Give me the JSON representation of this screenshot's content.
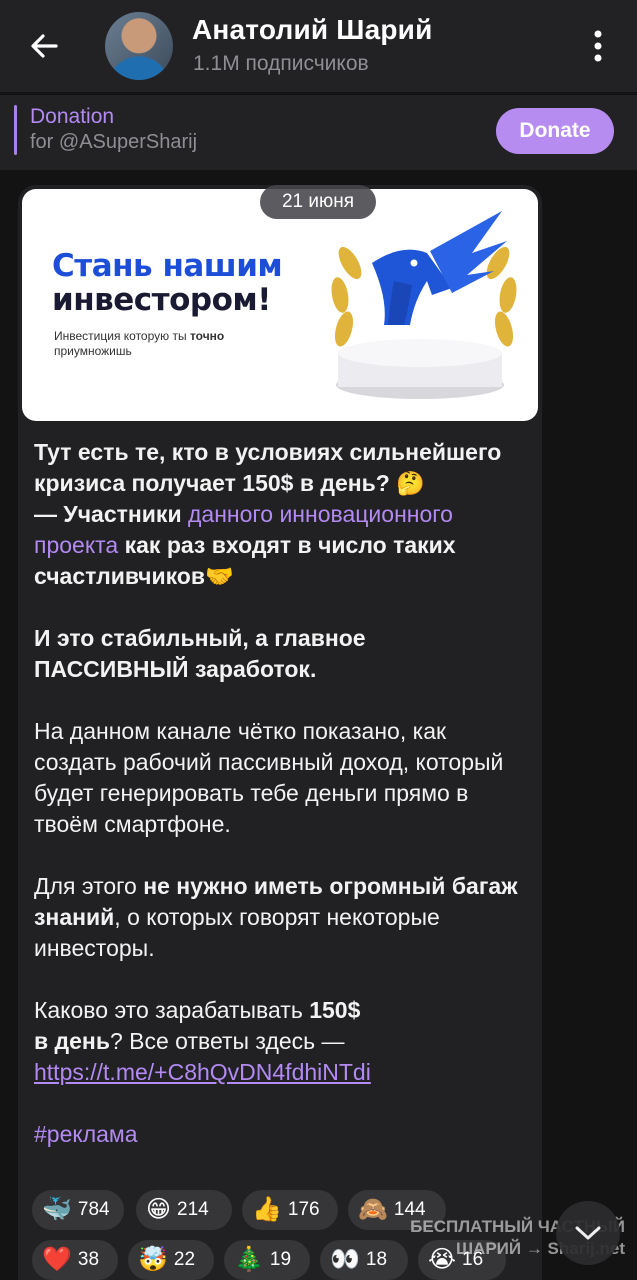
{
  "header": {
    "title": "Анатолий Шарий",
    "subtitle": "1.1M подписчиков"
  },
  "pinned": {
    "title": "Donation",
    "subtitle": "for @ASuperSharij",
    "button_label": "Donate"
  },
  "post": {
    "date": "21 июня",
    "ad_image": {
      "headline_line1": "Стань нашим",
      "headline_line2": "инвестором!",
      "subtext_part1": "Инвестиция которую ты ",
      "subtext_bold": "точно",
      "subtext_part2": " приумножишь"
    },
    "p1_bold_a": "Тут есть те, кто в условиях сильнейшего кризиса получает 150$ в день?",
    "p1_emoji": "🤔",
    "p1_bold_b": "— Участники ",
    "p1_link": "данного инновационного проекта",
    "p1_bold_c": " как раз входят в число таких счастливчиков",
    "p1_emoji2": "🤝",
    "p2": "И это стабильный, а главное ПАССИВНЫЙ заработок.",
    "p3": "На данном канале чётко показано, как создать рабочий пассивный доход, который будет генерировать тебе деньги прямо в твоём смартфоне.",
    "p4_a": "Для этого ",
    "p4_bold": "не нужно иметь огромный багаж знаний",
    "p4_b": ", о которых говорят некоторые инвесторы.",
    "p5_a": "Каково это зарабатывать ",
    "p5_bold1": "150$",
    "p5_bold2": "в день",
    "p5_b": "? Все ответы здесь —",
    "url": "https://t.me/+C8hQvDN4fdhiNTdi",
    "hashtag": "#реклама"
  },
  "reactions": [
    {
      "emoji": "🐳",
      "count": "784"
    },
    {
      "emoji": "😁",
      "count": "214"
    },
    {
      "emoji": "👍",
      "count": "176"
    },
    {
      "emoji": "🙈",
      "count": "144"
    },
    {
      "emoji": "❤️",
      "count": "38"
    },
    {
      "emoji": "🤯",
      "count": "22"
    },
    {
      "emoji": "🎄",
      "count": "19"
    },
    {
      "emoji": "👀",
      "count": "18"
    },
    {
      "emoji": "😭",
      "count": "16"
    }
  ],
  "watermark": {
    "line1": "БЕСПЛАТНЫЙ ЧАСТНЫЙ",
    "line2": "ШАРИЙ → Sharij.net"
  },
  "colors": {
    "accent": "#b28af2",
    "header_bg": "#222225",
    "bubble_bg": "#212124"
  }
}
